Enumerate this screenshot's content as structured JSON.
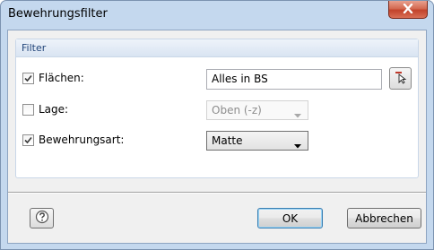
{
  "window": {
    "title": "Bewehrungsfilter"
  },
  "filter": {
    "group_title": "Filter",
    "flaechen": {
      "label": "Flächen:",
      "checked": true,
      "value": "Alles in BS"
    },
    "lage": {
      "label": "Lage:",
      "checked": false,
      "value": "Oben (-z)"
    },
    "bewehrungsart": {
      "label": "Bewehrungsart:",
      "checked": true,
      "value": "Matte"
    }
  },
  "buttons": {
    "ok": "OK",
    "cancel": "Abbrechen"
  },
  "icons": {
    "close": "close-icon",
    "pick": "pick-in-graphic-icon",
    "help": "help-icon"
  }
}
